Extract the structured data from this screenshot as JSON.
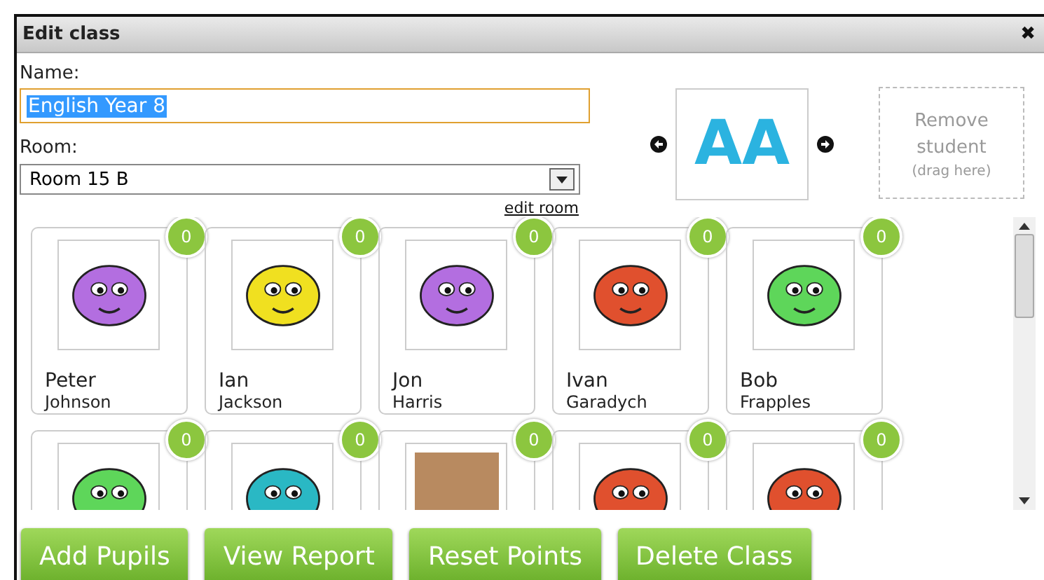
{
  "window": {
    "title": "Edit class",
    "close": "✖"
  },
  "form": {
    "name_label": "Name:",
    "name_value": "English Year 8",
    "room_label": "Room:",
    "room_value": "Room 15 B",
    "edit_room": "edit room"
  },
  "logo_text": "AA",
  "remove_zone": {
    "title": "Remove student",
    "hint": "(drag here)"
  },
  "students": [
    {
      "kind": "emoji",
      "first": "Peter",
      "last": "Johnson",
      "points": "0",
      "color": "#b36ee0"
    },
    {
      "kind": "emoji",
      "first": "Ian",
      "last": "Jackson",
      "points": "0",
      "color": "#f0e020"
    },
    {
      "kind": "emoji",
      "first": "Jon",
      "last": "Harris",
      "points": "0",
      "color": "#b36ee0"
    },
    {
      "kind": "emoji",
      "first": "Ivan",
      "last": "Garadych",
      "points": "0",
      "color": "#e0502e"
    },
    {
      "kind": "emoji",
      "first": "Bob",
      "last": "Frapples",
      "points": "0",
      "color": "#5ed65a"
    },
    {
      "kind": "emoji",
      "points": "0",
      "color": "#5ed65a"
    },
    {
      "kind": "emoji",
      "points": "0",
      "color": "#2ab8c4"
    },
    {
      "kind": "photo",
      "points": "0"
    },
    {
      "kind": "emoji",
      "points": "0",
      "color": "#e0502e"
    },
    {
      "kind": "emoji",
      "points": "0",
      "color": "#e0502e"
    }
  ],
  "buttons": [
    "Add Pupils",
    "View Report",
    "Reset Points",
    "Delete Class"
  ]
}
